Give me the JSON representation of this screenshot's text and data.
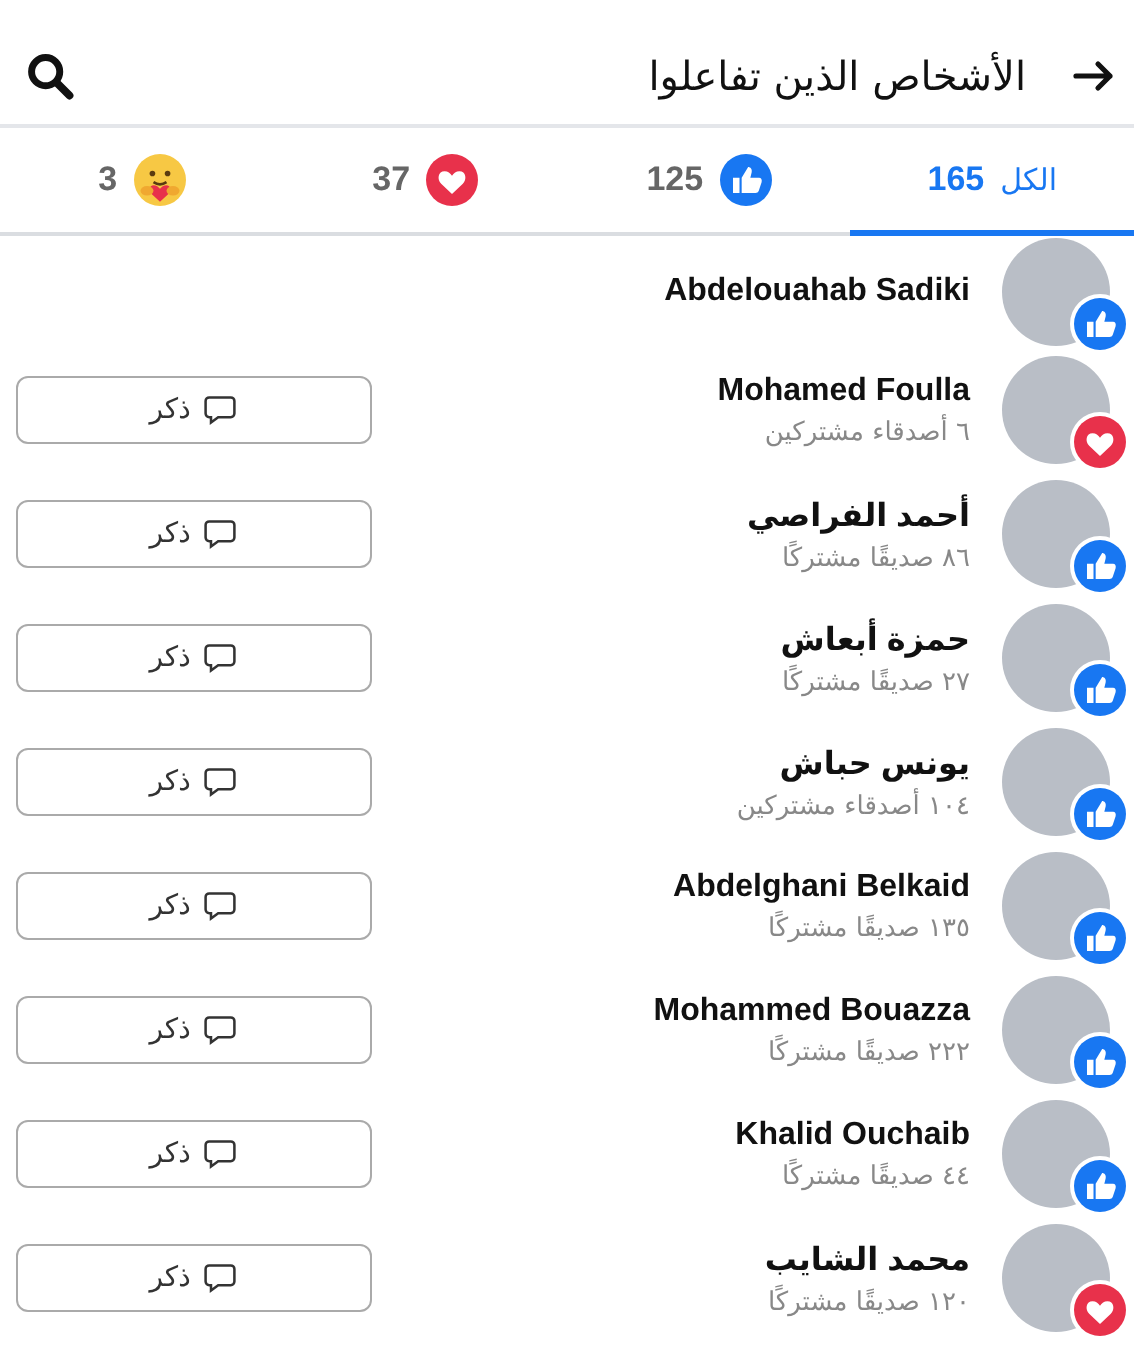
{
  "header": {
    "title": "الأشخاص الذين تفاعلوا"
  },
  "tabs": [
    {
      "kind": "all",
      "label": "الكل",
      "count": "165",
      "selected": true
    },
    {
      "kind": "like",
      "count": "125",
      "selected": false
    },
    {
      "kind": "love",
      "count": "37",
      "selected": false
    },
    {
      "kind": "care",
      "count": "3",
      "selected": false
    }
  ],
  "people": [
    {
      "name": "Abdelouahab Sadiki",
      "kind": "like"
    },
    {
      "name": "Mohamed Foulla",
      "mutual": "٦ أصدقاء مشتركين",
      "kind": "love",
      "button": "ذكر"
    },
    {
      "name": "أحمد الفراصي",
      "mutual": "٨٦ صديقًا مشتركًا",
      "kind": "like",
      "button": "ذكر"
    },
    {
      "name": "حمزة أبعاش",
      "mutual": "٢٧ صديقًا مشتركًا",
      "kind": "like",
      "button": "ذكر"
    },
    {
      "name": "يونس حباش",
      "mutual": "١٠٤ أصدقاء مشتركين",
      "kind": "like",
      "button": "ذكر"
    },
    {
      "name": "Abdelghani Belkaid",
      "mutual": "١٣٥ صديقًا مشتركًا",
      "kind": "like",
      "button": "ذكر"
    },
    {
      "name": "Mohammed Bouazza",
      "mutual": "٢٢٢ صديقًا مشتركًا",
      "kind": "like",
      "button": "ذكر"
    },
    {
      "name": "Khalid Ouchaib",
      "mutual": "٤٤ صديقًا مشتركًا",
      "kind": "like",
      "button": "ذكر"
    },
    {
      "name": "محمد الشايب",
      "mutual": "١٢٠ صديقًا مشتركًا",
      "kind": "love",
      "button": "ذكر"
    }
  ]
}
